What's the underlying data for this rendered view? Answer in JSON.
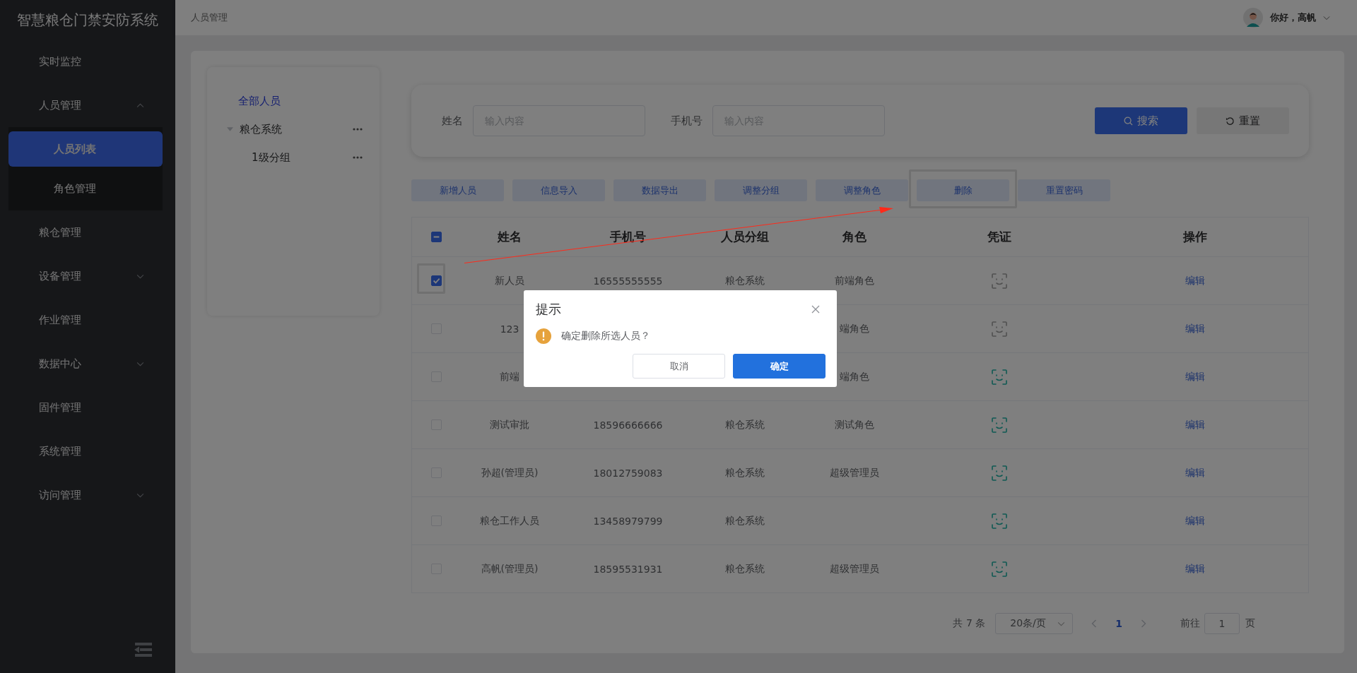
{
  "sidebar": {
    "title": "智慧粮仓门禁安防系统",
    "items": [
      {
        "label": "实时监控",
        "selected": false
      },
      {
        "label": "人员管理",
        "selected": false,
        "expanded": true,
        "children": [
          {
            "label": "人员列表",
            "selected": true
          },
          {
            "label": "角色管理",
            "selected": false
          }
        ]
      },
      {
        "label": "粮仓管理",
        "selected": false
      },
      {
        "label": "设备管理",
        "selected": false,
        "expanded": false
      },
      {
        "label": "作业管理",
        "selected": false
      },
      {
        "label": "数据中心",
        "selected": false,
        "expanded": false
      },
      {
        "label": "固件管理",
        "selected": false
      },
      {
        "label": "系统管理",
        "selected": false
      },
      {
        "label": "访问管理",
        "selected": false,
        "expanded": false
      }
    ]
  },
  "header": {
    "breadcrumb": "人员管理",
    "greeting": "你好，高帆"
  },
  "tree": {
    "items": [
      {
        "label": "全部人员",
        "selected": true
      },
      {
        "label": "粮仓系统",
        "selected": false,
        "expanded": true,
        "children": [
          {
            "label": "1级分组",
            "selected": false
          }
        ]
      }
    ]
  },
  "search": {
    "fields": [
      {
        "label": "姓名",
        "placeholder": "输入内容"
      },
      {
        "label": "手机号",
        "placeholder": "输入内容"
      }
    ],
    "search_button": "搜索",
    "reset_button": "重置"
  },
  "actions": [
    {
      "label": "新增人员",
      "annotated": false
    },
    {
      "label": "信息导入",
      "annotated": false
    },
    {
      "label": "数据导出",
      "annotated": false
    },
    {
      "label": "调整分组",
      "annotated": false
    },
    {
      "label": "调整角色",
      "annotated": false
    },
    {
      "label": "删除",
      "annotated": true
    },
    {
      "label": "重置密码",
      "annotated": false
    }
  ],
  "table": {
    "select_all": {
      "indeterminate": true
    },
    "columns": [
      "姓名",
      "手机号",
      "人员分组",
      "角色",
      "凭证",
      "操作"
    ],
    "rows": [
      {
        "checked": true,
        "annotated": true,
        "name": "新人员",
        "phone": "16555555555",
        "group": "粮仓系统",
        "role": "前端角色",
        "credential_registered": false,
        "action": "编辑"
      },
      {
        "checked": false,
        "annotated": false,
        "name": "123",
        "role": "端角色",
        "credential_registered": false,
        "action": "编辑"
      },
      {
        "checked": false,
        "annotated": false,
        "name": "前端",
        "role": "端角色",
        "credential_registered": true,
        "action": "编辑"
      },
      {
        "checked": false,
        "annotated": false,
        "name": "测试审批",
        "phone": "18596666666",
        "group": "粮仓系统",
        "role": "测试角色",
        "credential_registered": true,
        "action": "编辑"
      },
      {
        "checked": false,
        "annotated": false,
        "name": "孙超(管理员)",
        "phone": "18012759083",
        "group": "粮仓系统",
        "role": "超级管理员",
        "credential_registered": true,
        "action": "编辑"
      },
      {
        "checked": false,
        "annotated": false,
        "name": "粮仓工作人员",
        "phone": "13458979799",
        "group": "粮仓系统",
        "credential_registered": true,
        "action": "编辑"
      },
      {
        "checked": false,
        "annotated": false,
        "name": "高帆(管理员)",
        "phone": "18595531931",
        "group": "粮仓系统",
        "role": "超级管理员",
        "credential_registered": true,
        "action": "编辑"
      }
    ]
  },
  "pagination": {
    "total": "共 7 条",
    "page_size": "20条/页",
    "pages": [
      {
        "label": "1",
        "selected": true
      }
    ],
    "goto_label": "前往",
    "goto_value": "1",
    "goto_suffix": "页"
  },
  "dialog": {
    "title": "提示",
    "message": "确定删除所选人员？",
    "cancel": "取消",
    "confirm": "确定"
  }
}
